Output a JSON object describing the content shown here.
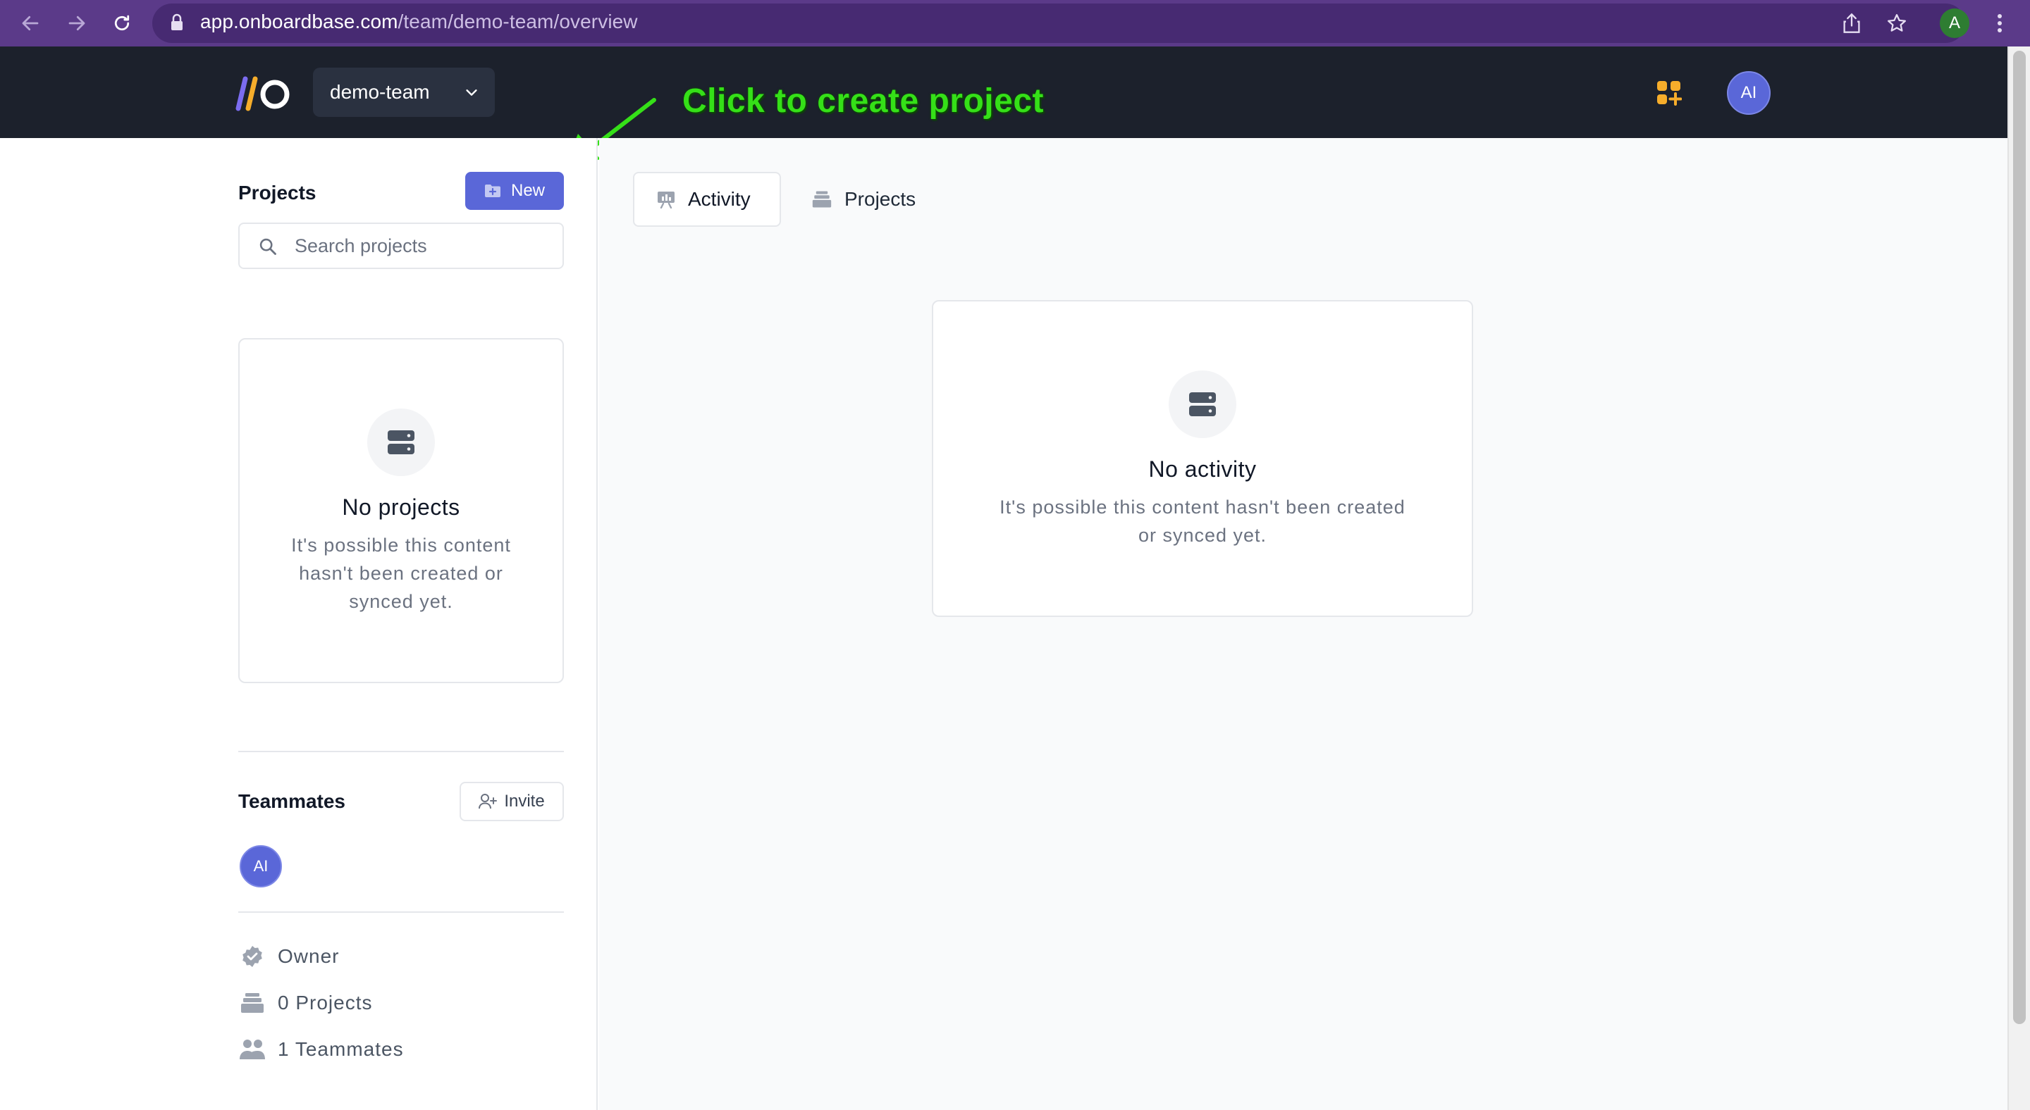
{
  "browser": {
    "url_domain": "app.onboardbase.com",
    "url_path": "/team/demo-team/overview",
    "profile_initial": "A"
  },
  "header": {
    "team_name": "demo-team",
    "avatar_initials": "AI"
  },
  "annotation": {
    "text": "Click to create project",
    "color": "#35e018"
  },
  "sidebar": {
    "projects_title": "Projects",
    "new_button_label": "New",
    "search_placeholder": "Search projects",
    "empty_title": "No projects",
    "empty_desc_line1": "It's possible this content",
    "empty_desc_line2": "hasn't been created or",
    "empty_desc_line3": "synced yet.",
    "teammates_title": "Teammates",
    "invite_button_label": "Invite",
    "teammate_initials": "AI",
    "stats": {
      "role": "Owner",
      "projects": "0 Projects",
      "teammates": "1 Teammates"
    }
  },
  "main": {
    "tabs": [
      {
        "label": "Activity"
      },
      {
        "label": "Projects"
      }
    ],
    "empty_title": "No activity",
    "empty_desc_line1": "It's possible this content hasn't been created",
    "empty_desc_line2": "or synced yet."
  },
  "colors": {
    "browser_bar": "#5b3a89",
    "app_header": "#1c212c",
    "accent": "#5a67d8",
    "apps_icon": "#f6ad2b"
  }
}
